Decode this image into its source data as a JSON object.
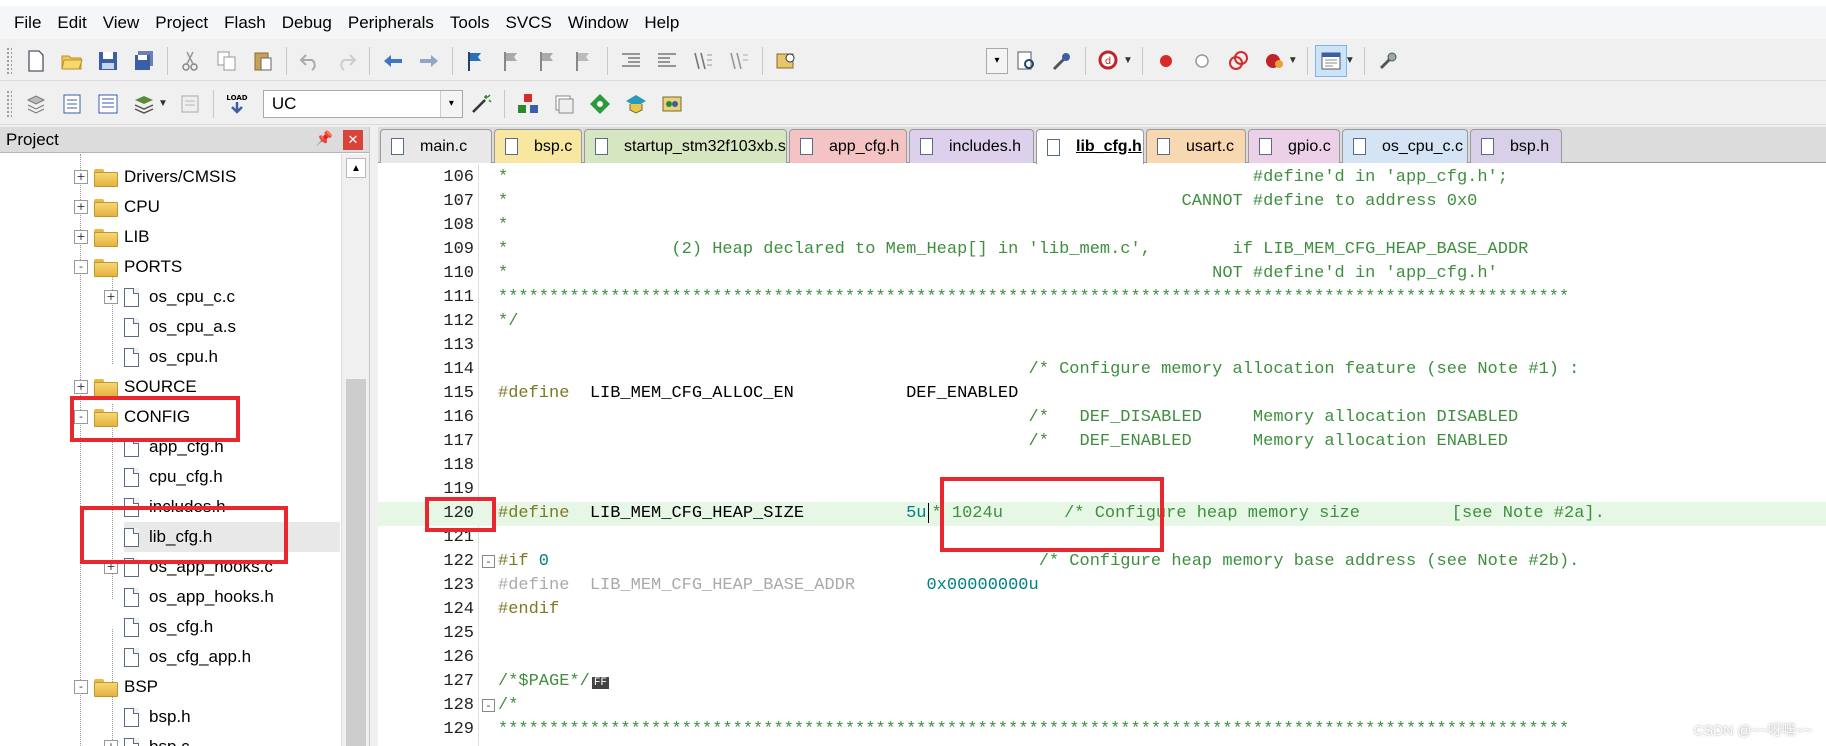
{
  "menu": [
    "File",
    "Edit",
    "View",
    "Project",
    "Flash",
    "Debug",
    "Peripherals",
    "Tools",
    "SVCS",
    "Window",
    "Help"
  ],
  "toolbar2": {
    "target_combo": "UC",
    "load_label": "LOAD"
  },
  "project_panel": {
    "title": "Project",
    "pin_icon": "pin-icon",
    "tree": [
      {
        "label": "Drivers/CMSIS",
        "type": "folder",
        "expander": "+"
      },
      {
        "label": "CPU",
        "type": "folder",
        "expander": "+"
      },
      {
        "label": "LIB",
        "type": "folder",
        "expander": "+"
      },
      {
        "label": "PORTS",
        "type": "folder",
        "expander": "-"
      },
      {
        "label": "os_cpu_c.c",
        "type": "file",
        "expander": "+"
      },
      {
        "label": "os_cpu_a.s",
        "type": "file"
      },
      {
        "label": "os_cpu.h",
        "type": "file"
      },
      {
        "label": "SOURCE",
        "type": "folder",
        "expander": "+"
      },
      {
        "label": "CONFIG",
        "type": "folder",
        "expander": "-"
      },
      {
        "label": "app_cfg.h",
        "type": "file"
      },
      {
        "label": "cpu_cfg.h",
        "type": "file"
      },
      {
        "label": "includes.h",
        "type": "file"
      },
      {
        "label": "lib_cfg.h",
        "type": "file",
        "selected": true
      },
      {
        "label": "os_app_hooks.c",
        "type": "file",
        "expander": "+"
      },
      {
        "label": "os_app_hooks.h",
        "type": "file"
      },
      {
        "label": "os_cfg.h",
        "type": "file"
      },
      {
        "label": "os_cfg_app.h",
        "type": "file"
      },
      {
        "label": "BSP",
        "type": "folder",
        "expander": "-"
      },
      {
        "label": "bsp.h",
        "type": "file"
      },
      {
        "label": "bsp.c",
        "type": "file",
        "expander": "+"
      }
    ]
  },
  "tabs": [
    {
      "label": "main.c",
      "color": "#e8e8e8"
    },
    {
      "label": "bsp.c",
      "color": "#f7e7a0"
    },
    {
      "label": "startup_stm32f103xb.s",
      "color": "#d6e6c0"
    },
    {
      "label": "app_cfg.h",
      "color": "#f4c4c4"
    },
    {
      "label": "includes.h",
      "color": "#dcd0ec"
    },
    {
      "label": "lib_cfg.h",
      "color": "#ffffff",
      "active": true
    },
    {
      "label": "usart.c",
      "color": "#f8d8b0"
    },
    {
      "label": "gpio.c",
      "color": "#ecd0e8"
    },
    {
      "label": "os_cpu_c.c",
      "color": "#d4e4f4"
    },
    {
      "label": "bsp.h",
      "color": "#d8d0e8"
    }
  ],
  "code_lines": [
    {
      "n": "106",
      "parts": [
        [
          "cmt",
          "*                                                                         #define'd in 'app_cfg.h';"
        ]
      ]
    },
    {
      "n": "107",
      "parts": [
        [
          "cmt",
          "*                                                                  CANNOT #define to address 0x0"
        ]
      ]
    },
    {
      "n": "108",
      "parts": [
        [
          "cmt",
          "*"
        ]
      ]
    },
    {
      "n": "109",
      "parts": [
        [
          "cmt",
          "*                (2) Heap declared to Mem_Heap[] in 'lib_mem.c',        if LIB_MEM_CFG_HEAP_BASE_ADDR"
        ]
      ]
    },
    {
      "n": "110",
      "parts": [
        [
          "cmt",
          "*                                                                     NOT #define'd in 'app_cfg.h'"
        ]
      ]
    },
    {
      "n": "111",
      "parts": [
        [
          "cmt",
          "*********************************************************************************************************"
        ]
      ]
    },
    {
      "n": "112",
      "parts": [
        [
          "cmt",
          "*/"
        ]
      ]
    },
    {
      "n": "113",
      "parts": [
        [
          "def",
          ""
        ]
      ]
    },
    {
      "n": "114",
      "parts": [
        [
          "cmt",
          "                                                    /* Configure memory allocation feature (see Note #1) :"
        ]
      ]
    },
    {
      "n": "115",
      "parts": [
        [
          "pre",
          "#define"
        ],
        [
          "def",
          "  LIB_MEM_CFG_ALLOC_EN           DEF_ENABLED"
        ]
      ]
    },
    {
      "n": "116",
      "parts": [
        [
          "cmt",
          "                                                    /*   DEF_DISABLED     Memory allocation DISABLED"
        ]
      ]
    },
    {
      "n": "117",
      "parts": [
        [
          "cmt",
          "                                                    /*   DEF_ENABLED      Memory allocation ENABLED"
        ]
      ]
    },
    {
      "n": "118",
      "parts": [
        [
          "def",
          ""
        ]
      ]
    },
    {
      "n": "119",
      "parts": [
        [
          "def",
          ""
        ]
      ]
    },
    {
      "n": "120",
      "hl": true,
      "parts": [
        [
          "pre",
          "#define"
        ],
        [
          "def",
          "  LIB_MEM_CFG_HEAP_SIZE          "
        ],
        [
          "num",
          "5u"
        ],
        [
          "caret",
          ""
        ],
        [
          "cmt",
          "* 1024u      /* Configure heap memory size         [see Note #2a]."
        ]
      ]
    },
    {
      "n": "121",
      "parts": [
        [
          "def",
          ""
        ]
      ]
    },
    {
      "n": "122",
      "fold": "-",
      "parts": [
        [
          "pre",
          "#if"
        ],
        [
          "num",
          " 0"
        ],
        [
          "cmt",
          "                                                /* Configure heap memory base address (see Note #2b)."
        ]
      ]
    },
    {
      "n": "123",
      "parts": [
        [
          "grey",
          "#define  LIB_MEM_CFG_HEAP_BASE_ADDR       "
        ],
        [
          "num",
          "0x00000000u"
        ]
      ]
    },
    {
      "n": "124",
      "parts": [
        [
          "pre",
          "#endif"
        ]
      ]
    },
    {
      "n": "125",
      "parts": [
        [
          "def",
          ""
        ]
      ]
    },
    {
      "n": "126",
      "parts": [
        [
          "def",
          ""
        ]
      ]
    },
    {
      "n": "127",
      "parts": [
        [
          "cmt",
          "/*$PAGE*/"
        ],
        [
          "def",
          "FF"
        ]
      ]
    },
    {
      "n": "128",
      "fold": "-",
      "parts": [
        [
          "cmt",
          "/*"
        ]
      ]
    },
    {
      "n": "129",
      "parts": [
        [
          "cmt",
          "*********************************************************************************************************"
        ]
      ]
    }
  ],
  "watermark": "CSDN @~~呀嘿~~"
}
